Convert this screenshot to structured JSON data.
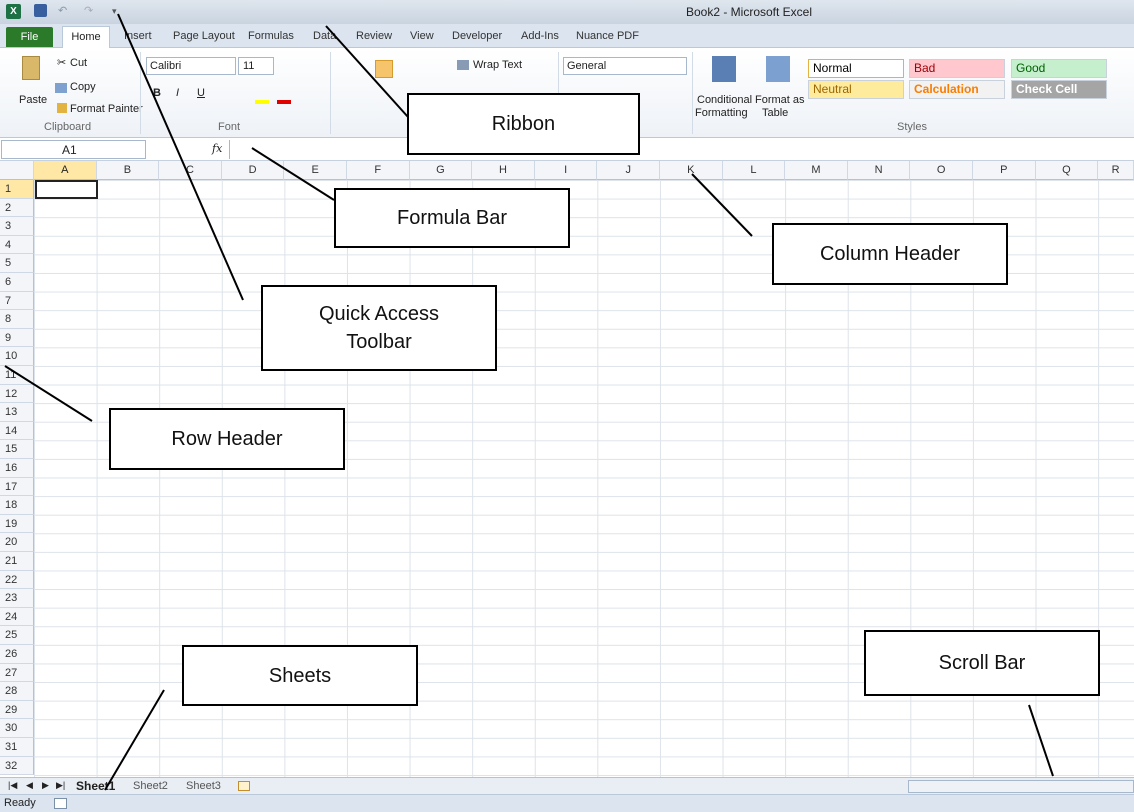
{
  "window": {
    "title": "Book2 - Microsoft Excel"
  },
  "tabs": [
    "File",
    "Home",
    "Insert",
    "Page Layout",
    "Formulas",
    "Data",
    "Review",
    "View",
    "Developer",
    "Add-Ins",
    "Nuance PDF"
  ],
  "clipboard": {
    "paste": "Paste",
    "cut": "Cut",
    "copy": "Copy",
    "format_painter": "Format Painter",
    "label": "Clipboard"
  },
  "font": {
    "name": "Calibri",
    "size": "11",
    "label": "Font",
    "bold": "B",
    "italic": "I",
    "underline": "U"
  },
  "alignment": {
    "wrap_text": "Wrap Text"
  },
  "number": {
    "format": "General"
  },
  "styles_group": {
    "conditional": "Conditional",
    "formatting": "Formatting",
    "format_as": "Format as",
    "table": "Table",
    "label": "Styles"
  },
  "styles": [
    {
      "name": "Normal",
      "bg": "#ffffff",
      "fg": "#000000"
    },
    {
      "name": "Bad",
      "bg": "#ffc7ce",
      "fg": "#9c0006"
    },
    {
      "name": "Good",
      "bg": "#c6efce",
      "fg": "#006100"
    },
    {
      "name": "Neutral",
      "bg": "#ffeb9c",
      "fg": "#9c6500"
    },
    {
      "name": "Calculation",
      "bg": "#f2f2f2",
      "fg": "#fa7d00"
    },
    {
      "name": "Check Cell",
      "bg": "#a5a5a5",
      "fg": "#ffffff"
    }
  ],
  "formula_bar": {
    "name_box": "A1",
    "fx": "fx",
    "value": ""
  },
  "columns": [
    "A",
    "B",
    "C",
    "D",
    "E",
    "F",
    "G",
    "H",
    "I",
    "J",
    "K",
    "L",
    "M",
    "N",
    "O",
    "P",
    "Q",
    "R"
  ],
  "rows": [
    "1",
    "2",
    "3",
    "4",
    "5",
    "6",
    "7",
    "8",
    "9",
    "10",
    "11",
    "12",
    "13",
    "14",
    "15",
    "16",
    "17",
    "18",
    "19",
    "20",
    "21",
    "22",
    "23",
    "24",
    "25",
    "26",
    "27",
    "28",
    "29",
    "30",
    "31",
    "32"
  ],
  "selected_cell": "A1",
  "sheets": [
    "Sheet1",
    "Sheet2",
    "Sheet3"
  ],
  "active_sheet": "Sheet1",
  "status": {
    "ready": "Ready"
  },
  "annotations": {
    "ribbon": "Ribbon",
    "formula_bar": "Formula Bar",
    "column_header": "Column Header",
    "quick_access_line1": "Quick Access",
    "quick_access_line2": "Toolbar",
    "row_header": "Row Header",
    "sheets": "Sheets",
    "scroll_bar": "Scroll Bar"
  },
  "colors": {
    "accent": "#217346",
    "file_tab": "#2a7a2a",
    "selection": "#222222",
    "annotation_border": "#000000"
  },
  "icons": [
    "excel-logo-icon",
    "save-icon",
    "undo-icon",
    "redo-icon",
    "customize-qat-icon",
    "paste-icon",
    "cut-icon",
    "copy-icon",
    "format-painter-icon",
    "fx-icon",
    "conditional-formatting-icon",
    "format-as-table-icon",
    "new-sheet-icon",
    "macro-record-icon"
  ]
}
